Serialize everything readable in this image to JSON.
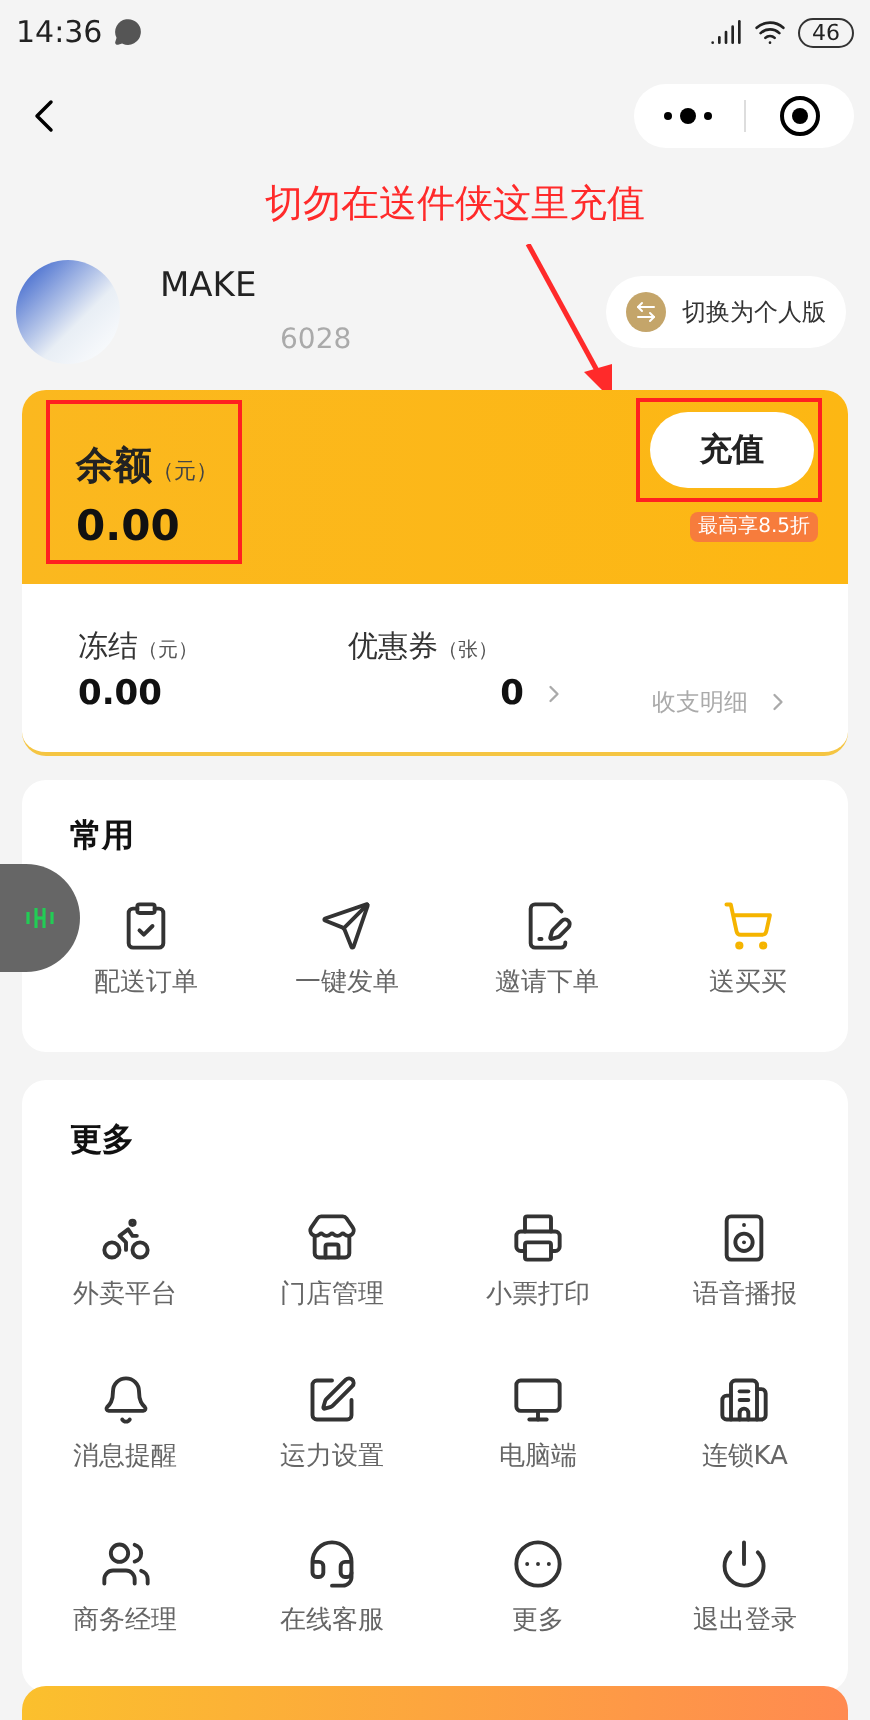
{
  "status_bar": {
    "time": "14:36",
    "battery": "46"
  },
  "annotation": {
    "text": "切勿在送件侠这里充值"
  },
  "profile": {
    "name": "MAKE",
    "phone": "6028",
    "switch_label": "切换为个人版"
  },
  "balance": {
    "label": "余额",
    "unit": "（元）",
    "value": "0.00",
    "recharge": "充值",
    "discount": "最高享8.5折"
  },
  "stats": [
    {
      "label": "冻结",
      "unit": "（元）",
      "value": "0.00"
    },
    {
      "label": "优惠券",
      "unit": "（张）",
      "value": "0"
    }
  ],
  "details_link": "收支明细",
  "common": {
    "title": "常用",
    "items": [
      "配送订单",
      "一键发单",
      "邀请下单",
      "送买买"
    ]
  },
  "more": {
    "title": "更多",
    "items": [
      "外卖平台",
      "门店管理",
      "小票打印",
      "语音播报",
      "消息提醒",
      "运力设置",
      "电脑端",
      "连锁KA",
      "商务经理",
      "在线客服",
      "更多",
      "退出登录"
    ]
  }
}
